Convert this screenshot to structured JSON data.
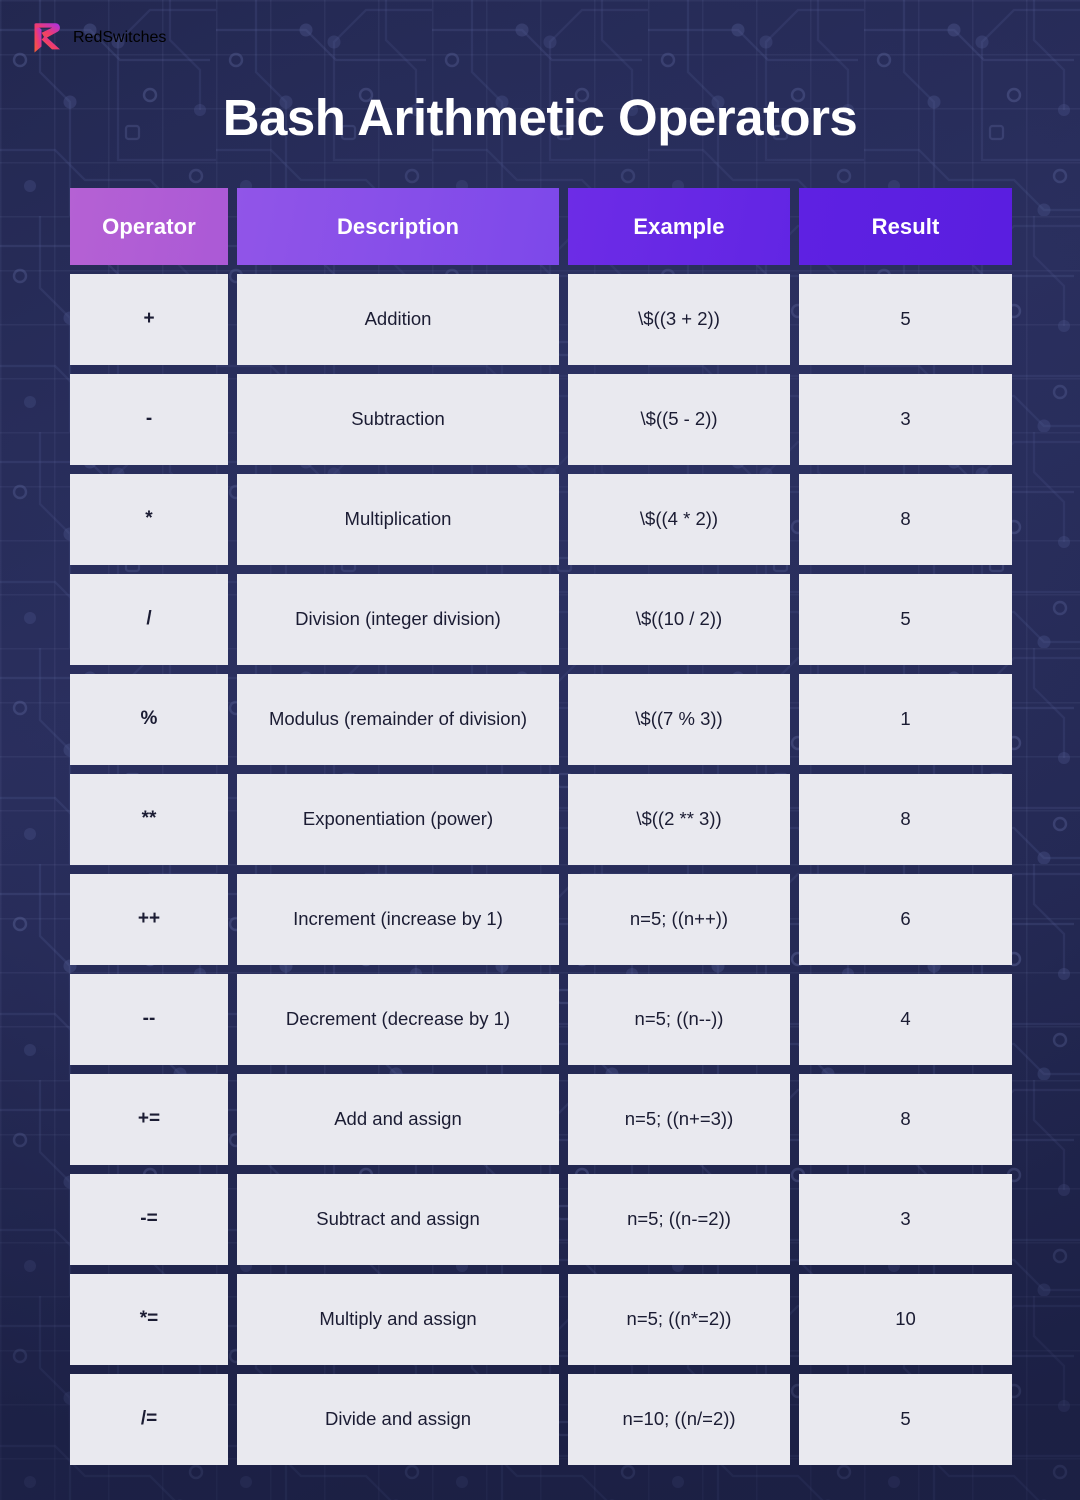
{
  "brand": {
    "name": "RedSwitches",
    "logo_icon": "redswitches-play-r-logo-icon",
    "logo_gradient_start": "#f26a3a",
    "logo_gradient_end": "#a733e8"
  },
  "title": "Bash Arithmetic Operators",
  "theme": {
    "page_background": "#262b55",
    "cell_background": "#e9e9ef",
    "cell_text": "#1b1c33",
    "header_text": "#ffffff",
    "header_gradient_start": "#b561d4",
    "header_gradient_end": "#5a1ee0"
  },
  "table": {
    "columns": [
      {
        "key": "operator",
        "label": "Operator"
      },
      {
        "key": "description",
        "label": "Description"
      },
      {
        "key": "example",
        "label": "Example"
      },
      {
        "key": "result",
        "label": "Result"
      }
    ],
    "rows": [
      {
        "operator": "+",
        "description": "Addition",
        "example": "\\$((3 + 2))",
        "result": "5"
      },
      {
        "operator": "-",
        "description": "Subtraction",
        "example": "\\$((5 - 2))",
        "result": "3"
      },
      {
        "operator": "*",
        "description": "Multiplication",
        "example": "\\$((4 * 2))",
        "result": "8"
      },
      {
        "operator": "/",
        "description": "Division (integer division)",
        "example": "\\$((10 / 2))",
        "result": "5"
      },
      {
        "operator": "%",
        "description": "Modulus (remainder of division)",
        "example": "\\$((7 % 3))",
        "result": "1"
      },
      {
        "operator": "**",
        "description": "Exponentiation (power)",
        "example": "\\$((2 ** 3))",
        "result": "8"
      },
      {
        "operator": "++",
        "description": "Increment (increase by 1)",
        "example": "n=5; ((n++))",
        "result": "6"
      },
      {
        "operator": "--",
        "description": "Decrement (decrease by 1)",
        "example": "n=5; ((n--))",
        "result": "4"
      },
      {
        "operator": "+=",
        "description": "Add and assign",
        "example": "n=5; ((n+=3))",
        "result": "8"
      },
      {
        "operator": "-=",
        "description": "Subtract and assign",
        "example": "n=5; ((n-=2))",
        "result": "3"
      },
      {
        "operator": "*=",
        "description": "Multiply and assign",
        "example": "n=5; ((n*=2))",
        "result": "10"
      },
      {
        "operator": "/=",
        "description": "Divide and assign",
        "example": "n=10; ((n/=2))",
        "result": "5"
      }
    ]
  }
}
